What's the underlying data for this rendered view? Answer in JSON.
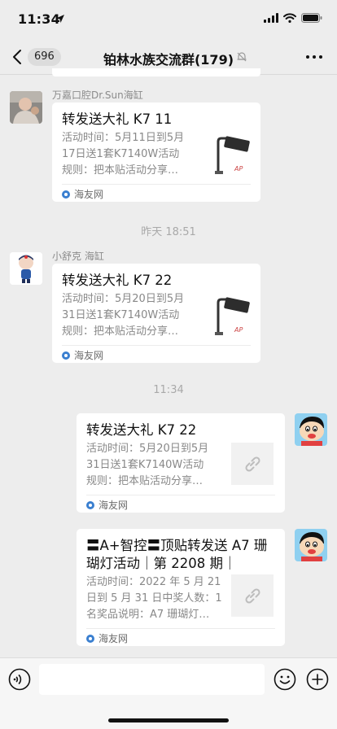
{
  "status": {
    "time": "11:34"
  },
  "nav": {
    "unread_count": "696",
    "title": "铂林水族交流群(179)"
  },
  "messages": [
    {
      "sender": "万嘉口腔Dr.Sun海缸",
      "title": "转发送大礼 K7 11",
      "desc": [
        "活动时间：5月11日到5月",
        "17日送1套K7140W活动",
        "规则：把本贴活动分享…"
      ],
      "source": "海友网",
      "thumb": "led-light-thumb"
    },
    {
      "timestamp": "昨天 18:51"
    },
    {
      "sender": "小舒克 海缸",
      "title": "转发送大礼 K7 22",
      "desc": [
        "活动时间：5月20日到5月",
        "31日送1套K7140W活动",
        "规则：把本贴活动分享…"
      ],
      "source": "海友网",
      "thumb": "led-light-thumb"
    },
    {
      "timestamp": "11:34"
    },
    {
      "title": "转发送大礼 K7 22",
      "desc": [
        "活动时间：5月20日到5月",
        "31日送1套K7140W活动",
        "规则：把本贴活动分享…"
      ],
      "source": "海友网",
      "thumb": "link-icon"
    },
    {
      "title": [
        "〓A+智控〓顶贴转发送 A7 珊",
        "瑚灯活动｜第 2208 期｜"
      ],
      "desc": [
        "活动时间：2022 年 5 月 21",
        "日到 5 月 31 日中奖人数：1",
        "名奖品说明：A7 珊瑚灯…"
      ],
      "source": "海友网",
      "thumb": "link-icon"
    }
  ],
  "thumb_watermark": "AP",
  "colors": {
    "background": "#ededed",
    "card": "#ffffff",
    "meta_text": "#888888"
  }
}
